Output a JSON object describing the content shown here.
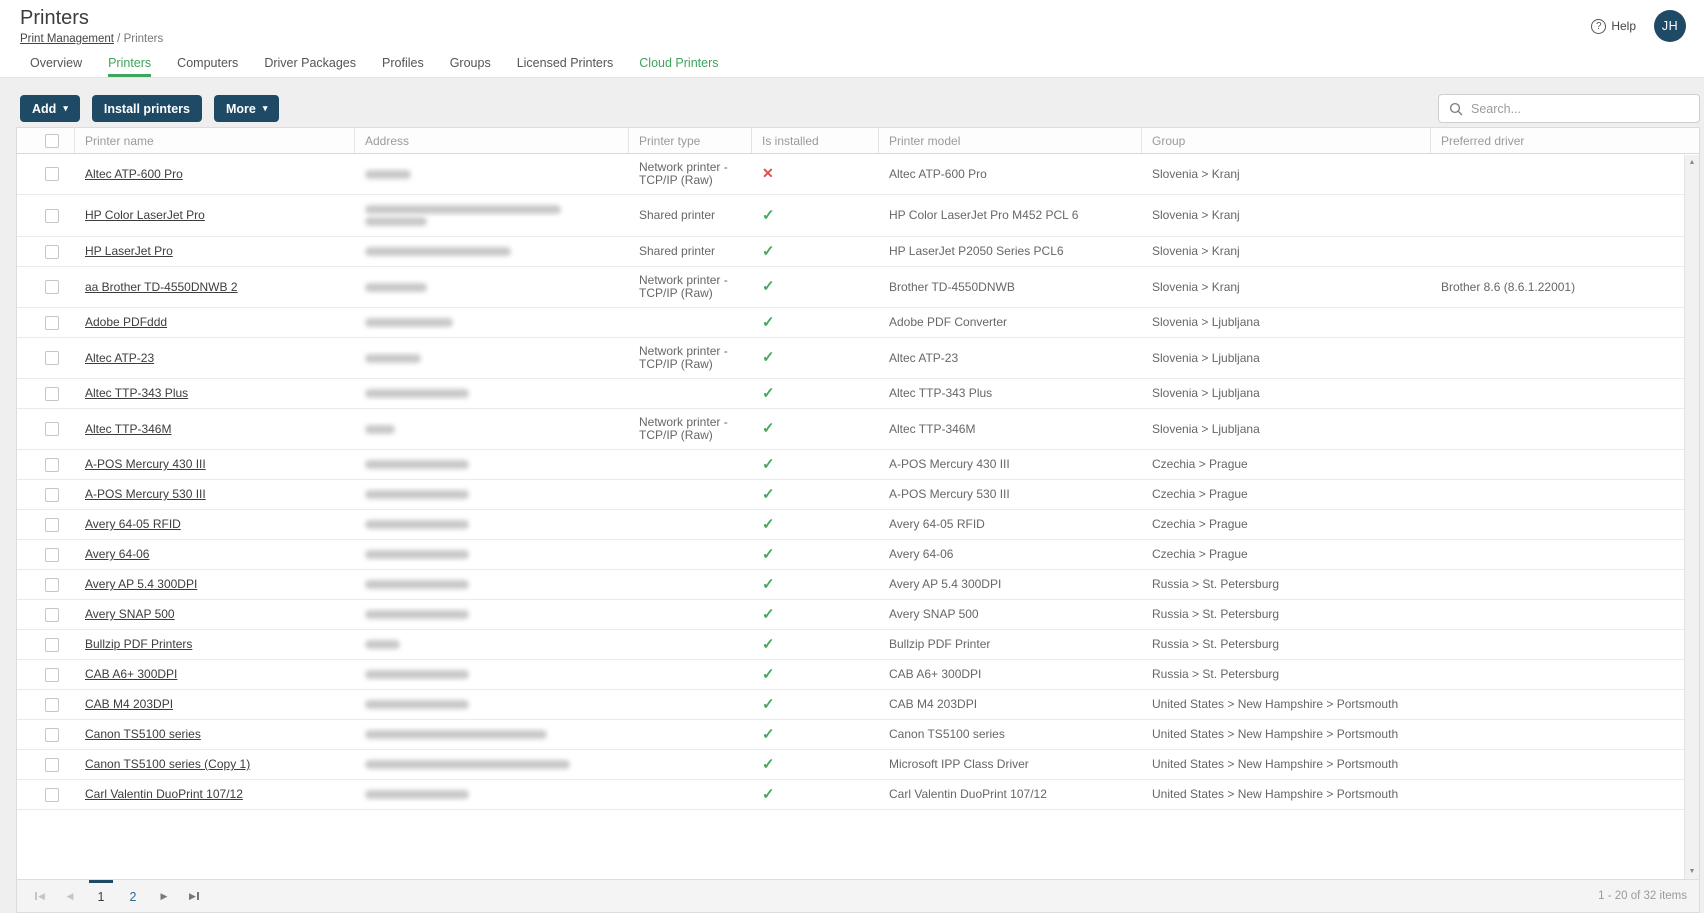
{
  "page": {
    "title": "Printers",
    "breadcrumb": {
      "parent": "Print Management",
      "separator": "/",
      "current": "Printers"
    },
    "help_label": "Help",
    "avatar_initials": "JH"
  },
  "tabs": [
    {
      "label": "Overview",
      "state": "normal"
    },
    {
      "label": "Printers",
      "state": "active"
    },
    {
      "label": "Computers",
      "state": "normal"
    },
    {
      "label": "Driver Packages",
      "state": "normal"
    },
    {
      "label": "Profiles",
      "state": "normal"
    },
    {
      "label": "Groups",
      "state": "normal"
    },
    {
      "label": "Licensed Printers",
      "state": "normal"
    },
    {
      "label": "Cloud Printers",
      "state": "highlight"
    }
  ],
  "toolbar": {
    "add_label": "Add",
    "install_label": "Install printers",
    "more_label": "More",
    "search_placeholder": "Search..."
  },
  "icons": {
    "caret_down": "▾",
    "check": "✓",
    "cross": "✕",
    "question": "?",
    "scroll_up": "▲",
    "scroll_down": "▼",
    "triangle_left": "◀",
    "triangle_right": "▶"
  },
  "table": {
    "columns": [
      "Printer name",
      "Address",
      "Printer type",
      "Is installed",
      "Printer model",
      "Group",
      "Preferred driver"
    ],
    "address_note": "values blurred/redacted in source screenshot",
    "rows": [
      {
        "name": "Altec ATP-600 Pro",
        "address_lines": [
          46
        ],
        "type": "Network printer - TCP/IP (Raw)",
        "installed": false,
        "model": "Altec ATP-600 Pro",
        "group": "Slovenia > Kranj",
        "preferred": ""
      },
      {
        "name": "HP Color LaserJet Pro",
        "address_lines": [
          196,
          62
        ],
        "type": "Shared printer",
        "installed": true,
        "model": "HP Color LaserJet Pro M452 PCL 6",
        "group": "Slovenia > Kranj",
        "preferred": ""
      },
      {
        "name": "HP LaserJet Pro",
        "address_lines": [
          146
        ],
        "type": "Shared printer",
        "installed": true,
        "model": "HP LaserJet P2050 Series PCL6",
        "group": "Slovenia > Kranj",
        "preferred": ""
      },
      {
        "name": "aa Brother TD-4550DNWB 2",
        "address_lines": [
          62
        ],
        "type": "Network printer - TCP/IP (Raw)",
        "installed": true,
        "model": "Brother TD-4550DNWB",
        "group": "Slovenia > Kranj",
        "preferred": "Brother 8.6 (8.6.1.22001)"
      },
      {
        "name": "Adobe PDFddd",
        "address_lines": [
          88
        ],
        "type": "",
        "installed": true,
        "model": "Adobe PDF Converter",
        "group": "Slovenia > Ljubljana",
        "preferred": ""
      },
      {
        "name": "Altec ATP-23",
        "address_lines": [
          56
        ],
        "type": "Network printer - TCP/IP (Raw)",
        "installed": true,
        "model": "Altec ATP-23",
        "group": "Slovenia > Ljubljana",
        "preferred": ""
      },
      {
        "name": "Altec TTP-343 Plus",
        "address_lines": [
          104
        ],
        "type": "",
        "installed": true,
        "model": "Altec TTP-343 Plus",
        "group": "Slovenia > Ljubljana",
        "preferred": ""
      },
      {
        "name": "Altec TTP-346M",
        "address_lines": [
          30
        ],
        "type": "Network printer - TCP/IP (Raw)",
        "installed": true,
        "model": "Altec TTP-346M",
        "group": "Slovenia > Ljubljana",
        "preferred": ""
      },
      {
        "name": "A-POS Mercury 430 III",
        "address_lines": [
          104
        ],
        "type": "",
        "installed": true,
        "model": "A-POS Mercury 430 III",
        "group": "Czechia > Prague",
        "preferred": ""
      },
      {
        "name": "A-POS Mercury 530 III",
        "address_lines": [
          104
        ],
        "type": "",
        "installed": true,
        "model": "A-POS Mercury 530 III",
        "group": "Czechia > Prague",
        "preferred": ""
      },
      {
        "name": "Avery 64-05 RFID",
        "address_lines": [
          104
        ],
        "type": "",
        "installed": true,
        "model": "Avery 64-05 RFID",
        "group": "Czechia > Prague",
        "preferred": ""
      },
      {
        "name": "Avery 64-06",
        "address_lines": [
          104
        ],
        "type": "",
        "installed": true,
        "model": "Avery 64-06",
        "group": "Czechia > Prague",
        "preferred": ""
      },
      {
        "name": "Avery AP 5.4 300DPI",
        "address_lines": [
          104
        ],
        "type": "",
        "installed": true,
        "model": "Avery AP 5.4 300DPI",
        "group": "Russia > St. Petersburg",
        "preferred": ""
      },
      {
        "name": "Avery SNAP 500",
        "address_lines": [
          104
        ],
        "type": "",
        "installed": true,
        "model": "Avery SNAP 500",
        "group": "Russia > St. Petersburg",
        "preferred": ""
      },
      {
        "name": "Bullzip PDF Printers",
        "address_lines": [
          35
        ],
        "type": "",
        "installed": true,
        "model": "Bullzip PDF Printer",
        "group": "Russia > St. Petersburg",
        "preferred": ""
      },
      {
        "name": "CAB A6+ 300DPI",
        "address_lines": [
          104
        ],
        "type": "",
        "installed": true,
        "model": "CAB A6+ 300DPI",
        "group": "Russia > St. Petersburg",
        "preferred": ""
      },
      {
        "name": "CAB M4 203DPI",
        "address_lines": [
          104
        ],
        "type": "",
        "installed": true,
        "model": "CAB M4 203DPI",
        "group": "United States > New Hampshire > Portsmouth",
        "preferred": ""
      },
      {
        "name": "Canon TS5100 series",
        "address_lines": [
          182
        ],
        "type": "",
        "installed": true,
        "model": "Canon TS5100 series",
        "group": "United States > New Hampshire > Portsmouth",
        "preferred": ""
      },
      {
        "name": "Canon TS5100 series (Copy 1)",
        "address_lines": [
          205
        ],
        "type": "",
        "installed": true,
        "model": "Microsoft IPP Class Driver",
        "group": "United States > New Hampshire > Portsmouth",
        "preferred": ""
      },
      {
        "name": "Carl Valentin DuoPrint 107/12",
        "address_lines": [
          104
        ],
        "type": "",
        "installed": true,
        "model": "Carl Valentin DuoPrint 107/12",
        "group": "United States > New Hampshire > Portsmouth",
        "preferred": ""
      }
    ]
  },
  "pager": {
    "pages": [
      "1",
      "2"
    ],
    "current": "1",
    "summary": "1 - 20 of 32 items"
  },
  "colors": {
    "navy": "#1e4a66",
    "accent_green": "#3fa45d",
    "check_green": "#44a963",
    "cross_red": "#e14e4e",
    "page_link": "#2d6e8f"
  }
}
